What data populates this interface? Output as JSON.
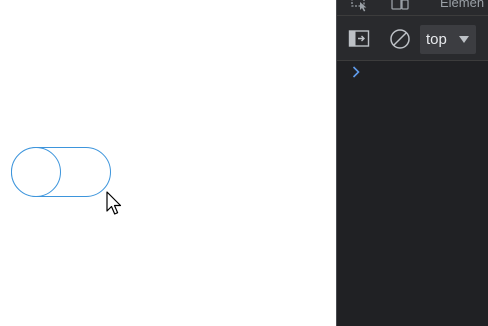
{
  "page": {
    "toggle": {
      "state": "off"
    }
  },
  "devtools": {
    "tabs": {
      "elements_label": "Elemen"
    },
    "toolbar": {
      "context_label": "top"
    },
    "console": {
      "prompt_symbol": "›"
    }
  },
  "colors": {
    "accent": "#3d95dc",
    "devtools_bg": "#202124",
    "devtools_toolbar": "#292a2d",
    "prompt": "#5f9bea"
  },
  "icons": {
    "cursor": "arrow-cursor-icon",
    "inspect": "inspect-element-icon",
    "device": "device-toolbar-icon",
    "sidebar": "console-sidebar-icon",
    "clear": "clear-console-icon",
    "dropdown": "dropdown-arrow-icon",
    "prompt": "console-prompt-icon"
  }
}
